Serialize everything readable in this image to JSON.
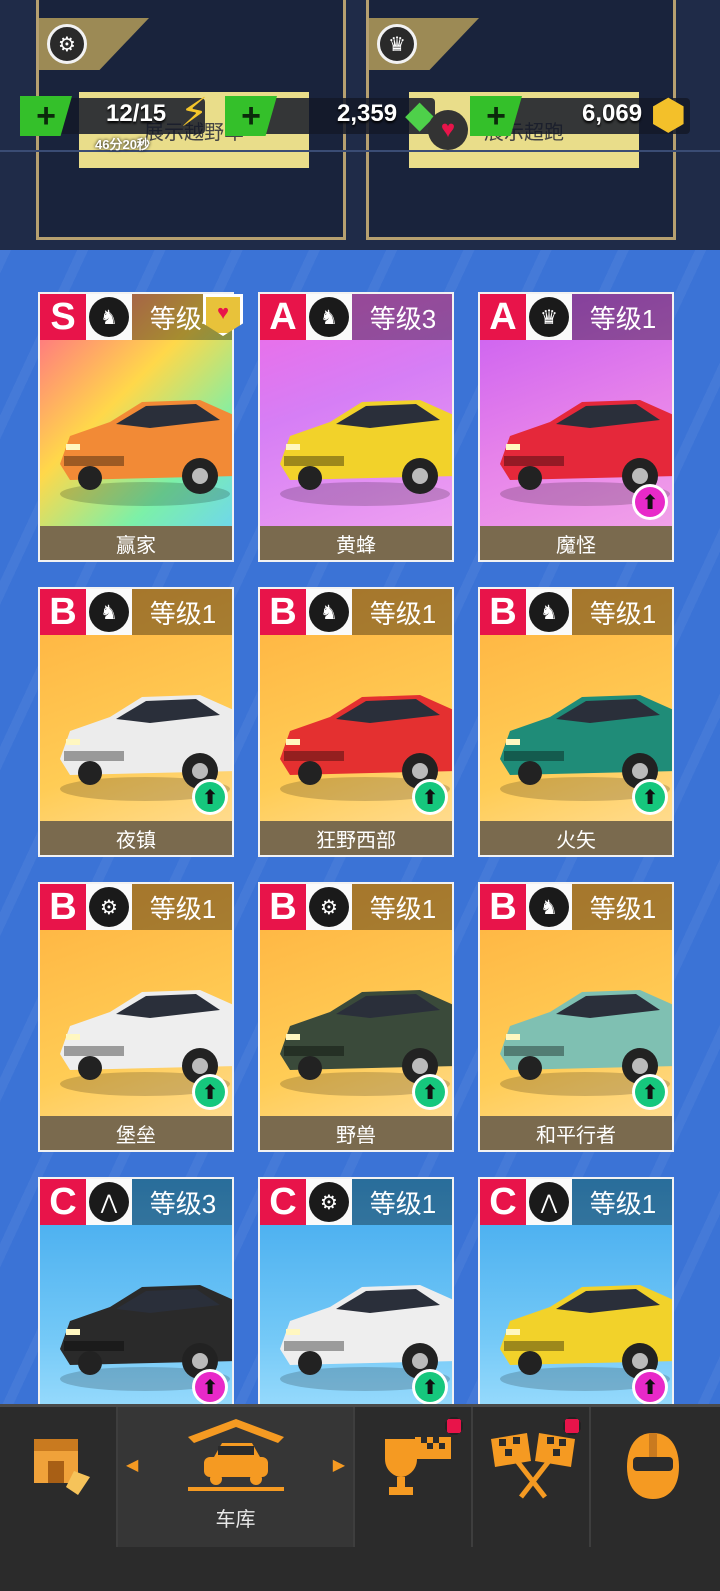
{
  "header": {
    "energy": "12/15",
    "timer": "46分20秒",
    "gems": "2,359",
    "gold": "6,069",
    "banner_left": "展示越野车",
    "banner_right": "展示超跑",
    "plus": "+"
  },
  "cards": [
    {
      "rank": "S",
      "level": "等级4",
      "name": "赢家",
      "class_icon": "horse-icon",
      "upgrade": false,
      "favorite": true
    },
    {
      "rank": "A",
      "level": "等级3",
      "name": "黄蜂",
      "class_icon": "horse-icon",
      "upgrade": false
    },
    {
      "rank": "A",
      "level": "等级1",
      "name": "魔怪",
      "class_icon": "crown-icon",
      "upgrade": true,
      "upgrade_color": "pink"
    },
    {
      "rank": "B",
      "level": "等级1",
      "name": "夜镇",
      "class_icon": "horse-icon",
      "upgrade": true,
      "upgrade_color": "green"
    },
    {
      "rank": "B",
      "level": "等级1",
      "name": "狂野西部",
      "class_icon": "horse-icon",
      "upgrade": true,
      "upgrade_color": "green"
    },
    {
      "rank": "B",
      "level": "等级1",
      "name": "火矢",
      "class_icon": "horse-icon",
      "upgrade": true,
      "upgrade_color": "green"
    },
    {
      "rank": "B",
      "level": "等级1",
      "name": "堡垒",
      "class_icon": "wheel-icon",
      "upgrade": true,
      "upgrade_color": "green"
    },
    {
      "rank": "B",
      "level": "等级1",
      "name": "野兽",
      "class_icon": "wheel-icon",
      "upgrade": true,
      "upgrade_color": "green"
    },
    {
      "rank": "B",
      "level": "等级1",
      "name": "和平行者",
      "class_icon": "horse-icon",
      "upgrade": true,
      "upgrade_color": "green"
    },
    {
      "rank": "C",
      "level": "等级3",
      "name": "",
      "class_icon": "road-icon",
      "upgrade": true,
      "upgrade_color": "pink"
    },
    {
      "rank": "C",
      "level": "等级1",
      "name": "",
      "class_icon": "wheel-icon",
      "upgrade": true,
      "upgrade_color": "green"
    },
    {
      "rank": "C",
      "level": "等级1",
      "name": "",
      "class_icon": "road-icon",
      "upgrade": true,
      "upgrade_color": "pink"
    }
  ],
  "nav": {
    "garage_label": "车库",
    "items": [
      "shop-icon",
      "garage-icon",
      "trophy-icon",
      "race-icon",
      "helmet-icon"
    ]
  },
  "colors": {
    "rank_red": "#e8144a",
    "upgrade_green": "#16c77d",
    "upgrade_pink": "#e829c9",
    "bg_blue": "#3b73d6",
    "nav_orange": "#f59a22"
  }
}
